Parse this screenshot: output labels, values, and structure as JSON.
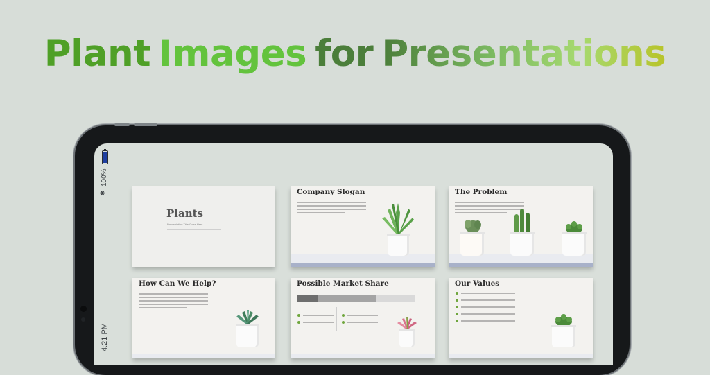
{
  "headline": {
    "words": [
      {
        "text": "Plant",
        "color": "#4fa027"
      },
      {
        "text": "Images",
        "color": "#63c33d"
      },
      {
        "text": "for",
        "color": "#4b7e3a"
      },
      {
        "text": "Presentations",
        "color": "#7dbb62"
      }
    ]
  },
  "status_bar": {
    "battery": "100%",
    "time": "4:21 PM",
    "bluetooth_icon": "bluetooth-icon",
    "battery_icon": "battery-icon"
  },
  "slides": [
    {
      "id": "plants",
      "title": "Plants",
      "subtitle": "Presentation Title Goes Here"
    },
    {
      "id": "company-slogan",
      "title": "Company Slogan"
    },
    {
      "id": "the-problem",
      "title": "The Problem"
    },
    {
      "id": "how-can-we-help",
      "title": "How Can We Help?"
    },
    {
      "id": "possible-market-share",
      "title": "Possible Market Share"
    },
    {
      "id": "our-values",
      "title": "Our Values"
    }
  ],
  "colors": {
    "background": "#d7ddd8",
    "tablet_frame": "#16181a",
    "plant_green": "#5aa24a",
    "pink_plant": "#d9738d"
  }
}
